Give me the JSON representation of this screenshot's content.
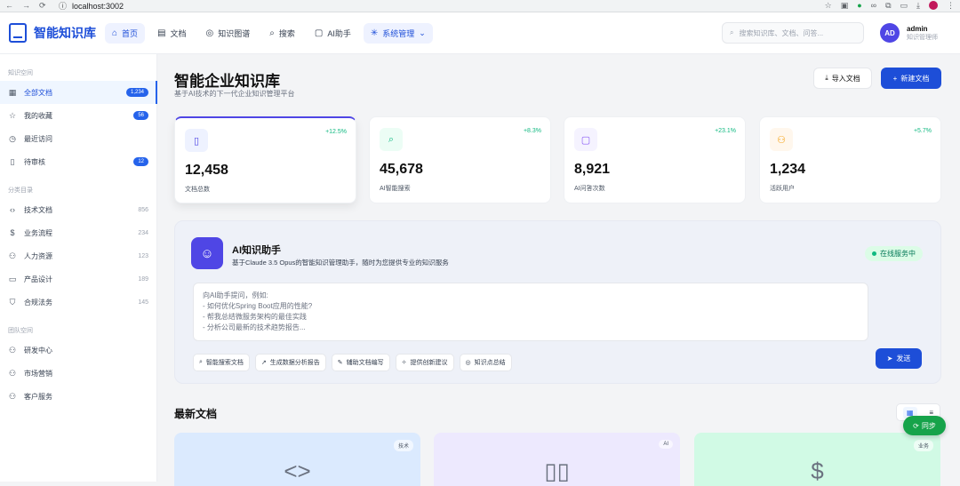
{
  "browser": {
    "url": "localhost:3002"
  },
  "app": {
    "title": "智能知识库"
  },
  "nav": {
    "items": [
      {
        "label": "首页",
        "icon": "home-icon"
      },
      {
        "label": "文档",
        "icon": "document-icon"
      },
      {
        "label": "知识图谱",
        "icon": "graph-icon"
      },
      {
        "label": "搜索",
        "icon": "search-icon"
      },
      {
        "label": "AI助手",
        "icon": "chat-icon"
      },
      {
        "label": "系统管理",
        "icon": "settings-icon"
      }
    ],
    "search_placeholder": "搜索知识库、文档、问答..."
  },
  "user": {
    "initials": "AD",
    "name": "admin",
    "role": "知识管理师"
  },
  "sidebar": {
    "knowledge_title": "知识空间",
    "knowledge": [
      {
        "label": "全部文档",
        "count": "1,234"
      },
      {
        "label": "我的收藏",
        "count": "56"
      },
      {
        "label": "最近访问",
        "count": ""
      },
      {
        "label": "待审核",
        "count": "12"
      }
    ],
    "category_title": "分类目录",
    "categories": [
      {
        "label": "技术文档",
        "count": "856"
      },
      {
        "label": "业务流程",
        "count": "234"
      },
      {
        "label": "人力资源",
        "count": "123"
      },
      {
        "label": "产品设计",
        "count": "189"
      },
      {
        "label": "合规法务",
        "count": "145"
      }
    ],
    "team_title": "团队空间",
    "teams": [
      {
        "label": "研发中心"
      },
      {
        "label": "市场营销"
      },
      {
        "label": "客户服务"
      }
    ]
  },
  "page": {
    "title": "智能企业知识库",
    "subtitle": "基于AI技术的下一代企业知识管理平台",
    "import_label": "导入文档",
    "new_label": "新建文档"
  },
  "stats": [
    {
      "value": "12,458",
      "label": "文档总数",
      "trend": "+12.5%",
      "icon": "file-icon",
      "color": "#4f46e5"
    },
    {
      "value": "45,678",
      "label": "AI智能搜索",
      "trend": "+8.3%",
      "icon": "search-icon",
      "color": "#10b981"
    },
    {
      "value": "8,921",
      "label": "AI问答次数",
      "trend": "+23.1%",
      "icon": "chat-icon",
      "color": "#8b5cf6"
    },
    {
      "value": "1,234",
      "label": "活跃用户",
      "trend": "+5.7%",
      "icon": "users-icon",
      "color": "#f59e0b"
    }
  ],
  "assistant": {
    "title": "AI知识助手",
    "desc": "基于Claude 3.5 Opus的智能知识管理助手，随时为您提供专业的知识服务",
    "status": "在线服务中",
    "placeholder": "向AI助手提问，例如:\n- 如何优化Spring Boot应用的性能?\n- 帮我总结微服务架构的最佳实践\n- 分析公司最新的技术趋势报告...",
    "chips": [
      "智能搜索文档",
      "生成数据分析报告",
      "辅助文档编写",
      "提供创新建议",
      "知识点总结"
    ],
    "send_label": "发送"
  },
  "recent": {
    "title": "最新文档",
    "cards": [
      {
        "tag": "技术",
        "icon": "code-icon",
        "glyph": "<>",
        "color": "#dbeafe"
      },
      {
        "tag": "AI",
        "icon": "book-icon",
        "glyph": "▯▯",
        "color": "#ede9fe"
      },
      {
        "tag": "业务",
        "icon": "dollar-icon",
        "glyph": "$",
        "color": "#d1fae5"
      }
    ]
  },
  "sync_label": "同步"
}
